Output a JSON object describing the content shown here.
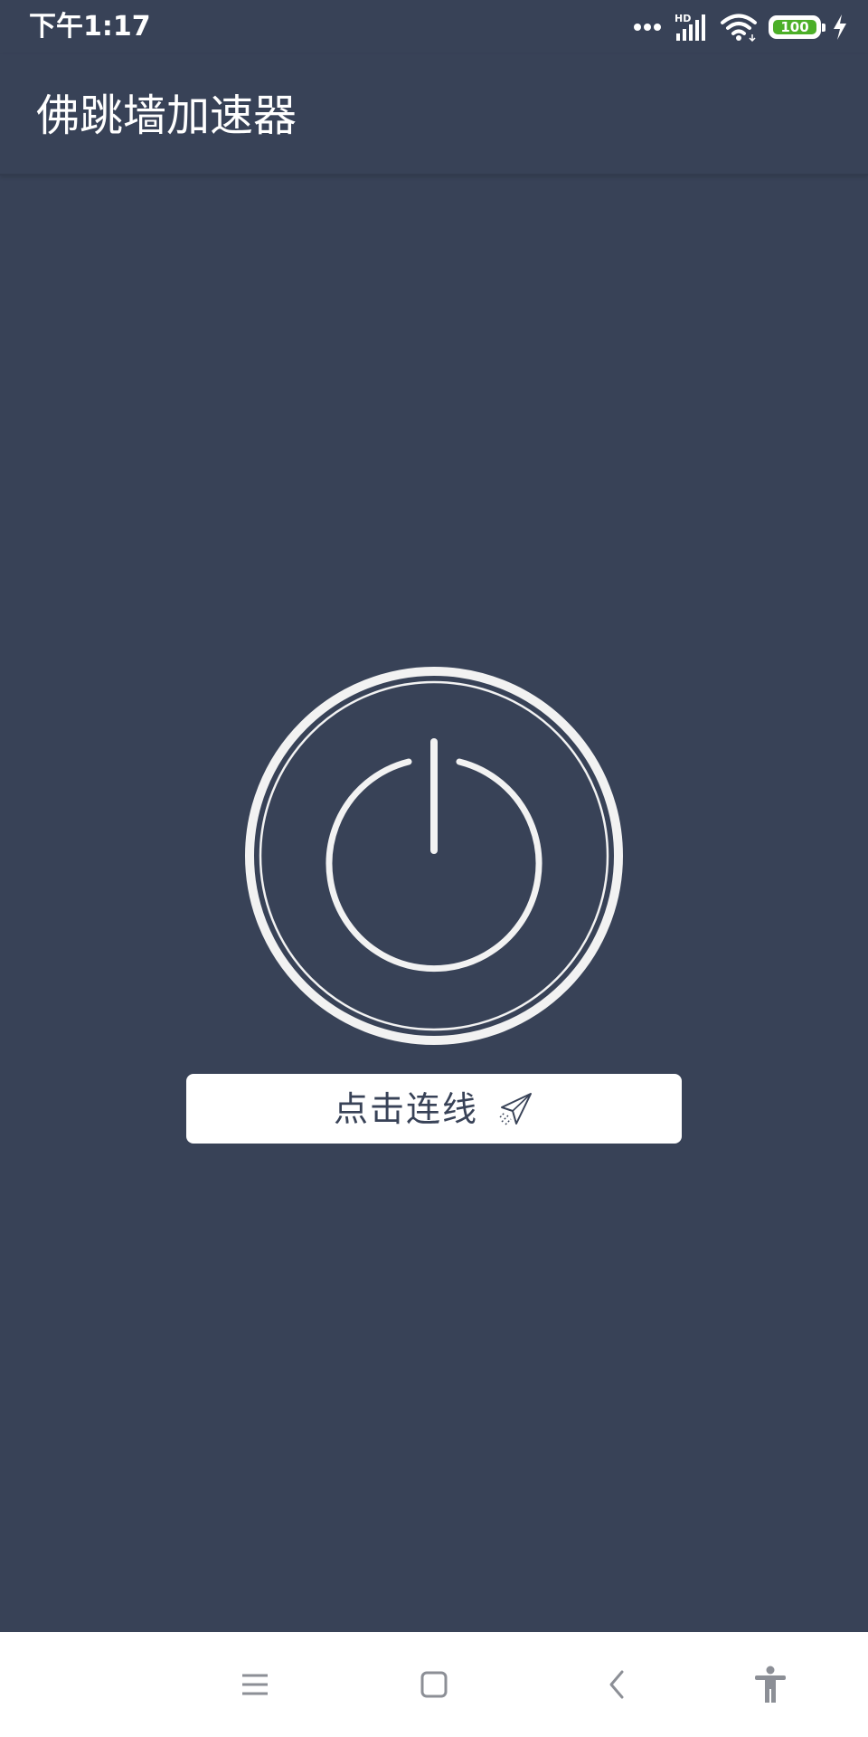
{
  "status_bar": {
    "time": "下午1:17",
    "network_label": "HD",
    "battery_level": "100",
    "battery_color": "#4caf28"
  },
  "app_bar": {
    "title": "佛跳墙加速器"
  },
  "power_button": {
    "icon": "power-icon",
    "state": "disconnected"
  },
  "connect_button": {
    "label": "点击连线",
    "icon": "paper-plane-icon"
  },
  "nav_bar": {
    "items": [
      {
        "icon": "menu-icon"
      },
      {
        "icon": "home-square-icon"
      },
      {
        "icon": "back-chevron-icon"
      },
      {
        "icon": "accessibility-icon"
      }
    ]
  },
  "colors": {
    "background": "#384257",
    "foreground": "#ffffff",
    "nav_bar": "#ffffff",
    "nav_icons": "#8c8f96"
  }
}
